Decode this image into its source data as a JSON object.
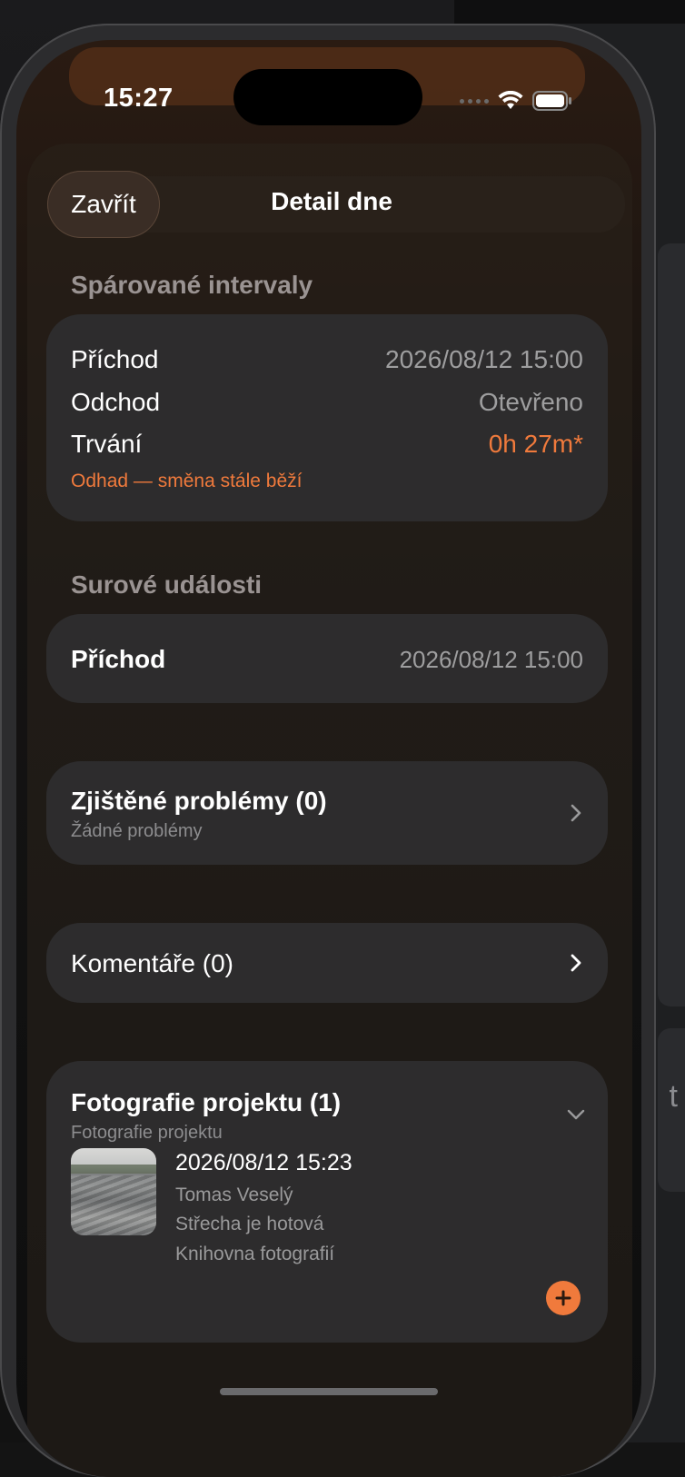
{
  "status_bar": {
    "time": "15:27"
  },
  "sheet": {
    "close_label": "Zavřít",
    "title": "Detail dne"
  },
  "paired": {
    "section_title": "Spárované intervaly",
    "rows": [
      {
        "label": "Příchod",
        "value": "2026/08/12 15:00"
      },
      {
        "label": "Odchod",
        "value": "Otevřeno"
      },
      {
        "label": "Trvání",
        "value": "0h 27m*"
      }
    ],
    "note": "Odhad — směna stále běží",
    "accent_color": "#f07a3c"
  },
  "raw_events": {
    "section_title": "Surové události",
    "event_label": "Příchod",
    "event_value": "2026/08/12 15:00"
  },
  "problems": {
    "title": "Zjištěné problémy (0)",
    "subtitle": "Žádné problémy",
    "icon": "chevron-right-icon"
  },
  "comments": {
    "title": "Komentáře (0)",
    "icon": "chevron-right-icon"
  },
  "photos": {
    "title": "Fotografie projektu (1)",
    "subtitle": "Fotografie projektu",
    "icon": "chevron-down-icon",
    "item": {
      "date": "2026/08/12 15:23",
      "author": "Tomas Veselý",
      "caption": "Střecha je hotová",
      "source": "Knihovna fotografií"
    },
    "add_icon": "plus-icon"
  },
  "background": {
    "letter": "t"
  }
}
